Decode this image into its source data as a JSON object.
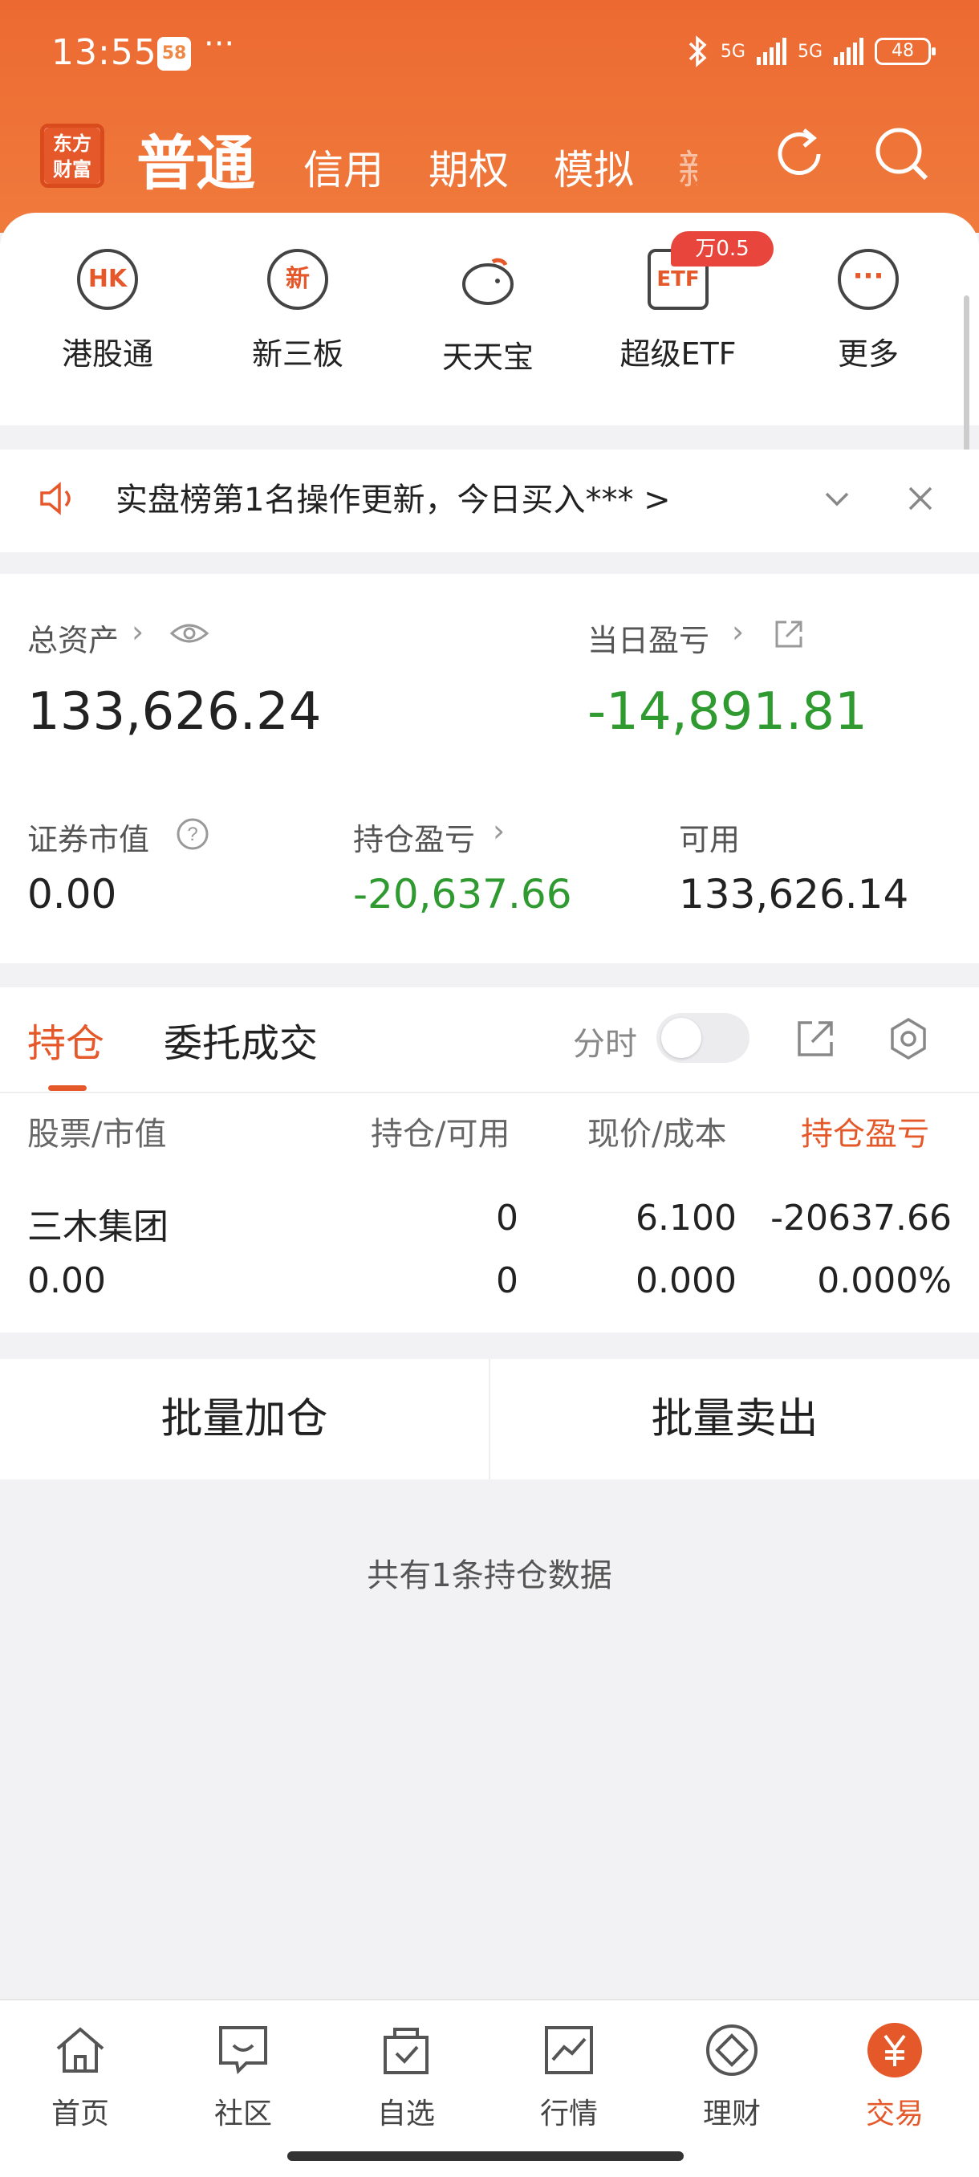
{
  "status_bar": {
    "time": "13:55",
    "app_badge": "58",
    "more": "···",
    "network1": "5G",
    "network2": "5G",
    "battery": "48"
  },
  "header": {
    "logo_line1": "东方",
    "logo_line2": "财富",
    "tabs": [
      "普通",
      "信用",
      "期权",
      "模拟"
    ],
    "active_tab": "普通",
    "partial_tab": "新股"
  },
  "quick_access": {
    "items": [
      {
        "label": "港股通",
        "icon": "HK"
      },
      {
        "label": "新三板",
        "icon": "新"
      },
      {
        "label": "天天宝",
        "icon": "piggy-bank"
      },
      {
        "label": "超级ETF",
        "icon": "ETF"
      },
      {
        "label": "更多",
        "icon": "···"
      }
    ],
    "etf_badge": "万0.5"
  },
  "notice": {
    "text": "实盘榜第1名操作更新，今日买入*** >"
  },
  "assets": {
    "total_label": "总资产",
    "total_value": "133,626.24",
    "daily_pl_label": "当日盈亏",
    "daily_pl_value": "-14,891.81",
    "market_value_label": "证券市值",
    "market_value": "0.00",
    "position_pl_label": "持仓盈亏",
    "position_pl_value": "-20,637.66",
    "available_label": "可用",
    "available_value": "133,626.14"
  },
  "positions": {
    "tabs": [
      "持仓",
      "委托成交"
    ],
    "time_share_label": "分时",
    "columns": [
      "股票/市值",
      "持仓/可用",
      "现价/成本",
      "持仓盈亏"
    ],
    "rows": [
      {
        "name": "三木集团",
        "market_value": "0.00",
        "holding": "0",
        "available": "0",
        "price": "6.100",
        "cost": "0.000",
        "pl": "-20637.66",
        "pl_pct": "0.000%"
      }
    ]
  },
  "actions": {
    "batch_add": "批量加仓",
    "batch_sell": "批量卖出"
  },
  "summary": {
    "count_text": "共有1条持仓数据"
  },
  "bottom_nav": {
    "items": [
      {
        "label": "首页",
        "icon": "home"
      },
      {
        "label": "社区",
        "icon": "chat"
      },
      {
        "label": "自选",
        "icon": "bag-check"
      },
      {
        "label": "行情",
        "icon": "chart"
      },
      {
        "label": "理财",
        "icon": "diamond"
      },
      {
        "label": "交易",
        "icon": "yen"
      }
    ],
    "active": "交易"
  },
  "colors": {
    "accent": "#e5582a",
    "header_bg": "#ec6a32",
    "gain_green": "#2f9a2f"
  }
}
